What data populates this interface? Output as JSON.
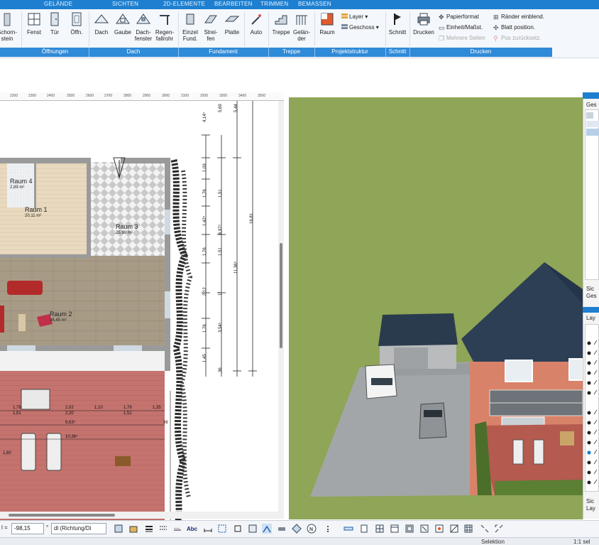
{
  "ribbon_tabs": [
    "GELÄNDE",
    "SICHTEN",
    "2D-ELEMENTE",
    "BEARBEITEN",
    "TRIMMEN",
    "BEMASSEN"
  ],
  "buttons": {
    "schornstein": "Schorn-\nstein",
    "fenster": "Fenst",
    "tuer": "Tür",
    "oeffnung": "Öffn.",
    "dach": "Dach",
    "gaube": "Gaube",
    "dachfenster": "Dach-\nfenster",
    "regenfallrohr": "Regen-\nfallrohr",
    "einzelfund": "Einzel\nFund.",
    "streifenfund": "Strei-\nfen",
    "platte": "Platte",
    "auto": "Auto",
    "treppe": "Treppe",
    "gelaender": "Gelän-\nder",
    "raum": "Raum",
    "schnitt": "Schnitt",
    "drucken": "Drucken"
  },
  "small_buttons": {
    "layer": "Layer",
    "geschoss": "Geschoss",
    "papierformat": "Papierformat",
    "einheit": "Einheit/Maßst.",
    "mehrere_seiten": "Mehrere Seiten",
    "raender": "Ränder einblend.",
    "blatt": "Blatt position.",
    "pos_zurueck": "Pos zurücksetz."
  },
  "groups": [
    "Öffnungen",
    "Dach",
    "Fundament",
    "Treppe",
    "Projektstruktur",
    "Schnitt",
    "Drucken"
  ],
  "ruler_top": [
    "2200",
    "2300",
    "2400",
    "2500",
    "2600",
    "2700",
    "2800",
    "2900",
    "3000",
    "3100",
    "3200",
    "3300",
    "3400",
    "3500"
  ],
  "rooms": [
    {
      "name": "Raum 4",
      "area": "2,89 m²"
    },
    {
      "name": "Raum 1",
      "area": "20,11 m²"
    },
    {
      "name": "Raum 3",
      "area": "25,90 m²"
    },
    {
      "name": "Raum 2",
      "area": "36,45 m²"
    }
  ],
  "dimensions_vertical": [
    "4,14⁵",
    "5,69",
    "5,44",
    "1,09",
    "1,76",
    "1,51",
    "1,42⁵",
    "6,97⁵",
    "1,76",
    "1,51",
    "11,36⁵",
    "16,81",
    "2,12",
    "1²",
    "1,76",
    "1,51",
    "3,54⁵",
    "1,45",
    "36"
  ],
  "dimensions_horizontal": [
    "1,76",
    "1,51",
    "2,02",
    "2,20",
    "1,10",
    "1,76",
    "1,51",
    "1,35",
    "9,63⁵",
    "10,36⁵",
    "1,60",
    "36"
  ],
  "right_panel": {
    "top_label": "Ges",
    "mid_label_1": "Sic",
    "mid_label_2": "Ges",
    "layer_label": "Lay",
    "bottom_label_1": "Sic",
    "bottom_label_2": "Lay"
  },
  "bottom": {
    "field_prefix": "l =",
    "field_value": "-98,15",
    "unit_hint": "°",
    "direction_select": "dl (Richtung/Di"
  },
  "status": {
    "mode": "Selektion",
    "scale": "1:1 sel"
  },
  "colors": {
    "ribbon_blue": "#1e7fd0",
    "grass": "#8ea356",
    "terrace": "#c4736e",
    "roof": "#2d3f55",
    "facade": "#d9826a"
  }
}
